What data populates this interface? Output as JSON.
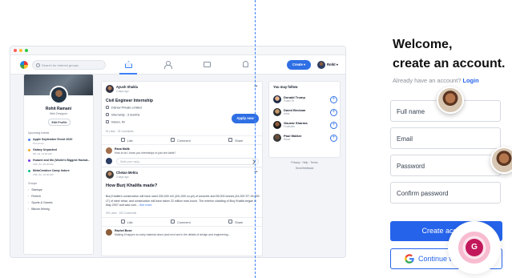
{
  "mockup": {
    "search_placeholder": "Search for interest groups",
    "create_label": "Create",
    "user_label": "Rohit",
    "profile": {
      "name": "Rohit Ramani",
      "subtitle": "Web Designer",
      "edit_label": "Edit Profile"
    },
    "upcoming": {
      "title": "Upcoming events",
      "events": [
        {
          "name": "Apple September Event 2020",
          "meta": "Tomorrow",
          "color": "#4f7cf7"
        },
        {
          "name": "Galaxy Unpacked",
          "meta": "8th Jul, 11:00 AM",
          "color": "#f5a524"
        },
        {
          "name": "Huawei and Mo (World's Biggest Hackat...",
          "meta": "12th Jul, 09:00 AM",
          "color": "#7c3aed"
        },
        {
          "name": "MetaCreation Camp Indore",
          "meta": "15th Jul, 10:00 AM",
          "color": "#10b981"
        }
      ]
    },
    "groups": {
      "title": "Groups",
      "items": [
        "Startups",
        "Fintech",
        "Sports & Games",
        "Bitcoin Mining"
      ]
    },
    "post1": {
      "author": "Ayush Shukla",
      "meta": "2 days ago",
      "title": "Civil Engineer Internship",
      "company": "Disnav Private Limited",
      "duration": "Internship : 3 months",
      "location": "Indore, IN",
      "apply_label": "Apply now",
      "stats": "91 Likes · 32 Comments",
      "actions": [
        "Like",
        "Comment",
        "Share"
      ],
      "comment_author": "Rana Malik",
      "comment_text": "How to do I know you internships in just one table?",
      "reply_placeholder": "Write your reply..."
    },
    "post2": {
      "author": "Chetan Mehta",
      "meta": "2 days ago",
      "title": "How Burj Khalifa made?",
      "body": "Burj Khalifa's construction will have used 330,000 m3 (431,000 cu yd) of concrete and 55,000 tonnes (61,000 ST; 54,000 LT) of steel rebar, and construction will have taken 22 million man-hours. The exterior cladding of Burj Khalifa began in May 2007 and was com...",
      "see_more": "See more",
      "stats": "391 Likes · 192 Comments",
      "actions": [
        "Like",
        "Comment",
        "Share"
      ],
      "comment_author": "Rachel Bose",
      "comment_text": "Making it happen so early material down (and next are in the details of design and engineering..."
    },
    "follow": {
      "title": "You may follow",
      "people": [
        {
          "name": "Donald Trump",
          "role": "Public Fit",
          "color": "#e7b48e"
        },
        {
          "name": "David Beckam",
          "role": "Artist",
          "color": "#c49a6c"
        },
        {
          "name": "Gaurav Sharma",
          "role": "Footballer",
          "color": "#8d5b3c"
        },
        {
          "name": "Paul Walker",
          "role": "Racer",
          "color": "#6b4f3a"
        }
      ],
      "links": "Privacy · Help · Terms",
      "feedback": "Send feedback"
    }
  },
  "signup": {
    "heading_line1": "Welcome,",
    "heading_line2": "create an account.",
    "already_text": "Already have an account?",
    "login_label": "Login",
    "fields": [
      "Full name",
      "Email",
      "Password",
      "Confirm password"
    ],
    "create_label": "Create account",
    "google_label": "Continue with Google",
    "google_avatar_letter": "G"
  },
  "colors": {
    "accent": "#2563eb",
    "divider": "#3b82f6"
  }
}
